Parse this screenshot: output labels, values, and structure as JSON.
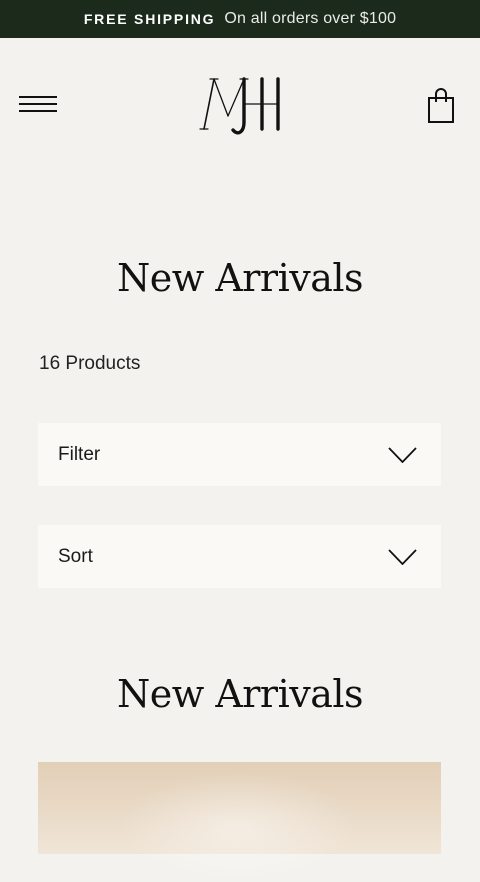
{
  "announcement": {
    "strong_text": "FREE SHIPPING",
    "light_text": "On all orders over $100",
    "bg_color": "#1c2a1c"
  },
  "header": {
    "menu_icon": "hamburger-menu-icon",
    "logo_text": "MJH",
    "cart_icon": "shopping-bag-icon"
  },
  "collection": {
    "title": "New Arrivals",
    "product_count": "16 Products",
    "filter_label": "Filter",
    "sort_label": "Sort",
    "section_title": "New Arrivals"
  },
  "colors": {
    "page_bg": "#f4f2ee",
    "dropdown_bg": "#faf9f6",
    "text": "#1a1a1a"
  }
}
